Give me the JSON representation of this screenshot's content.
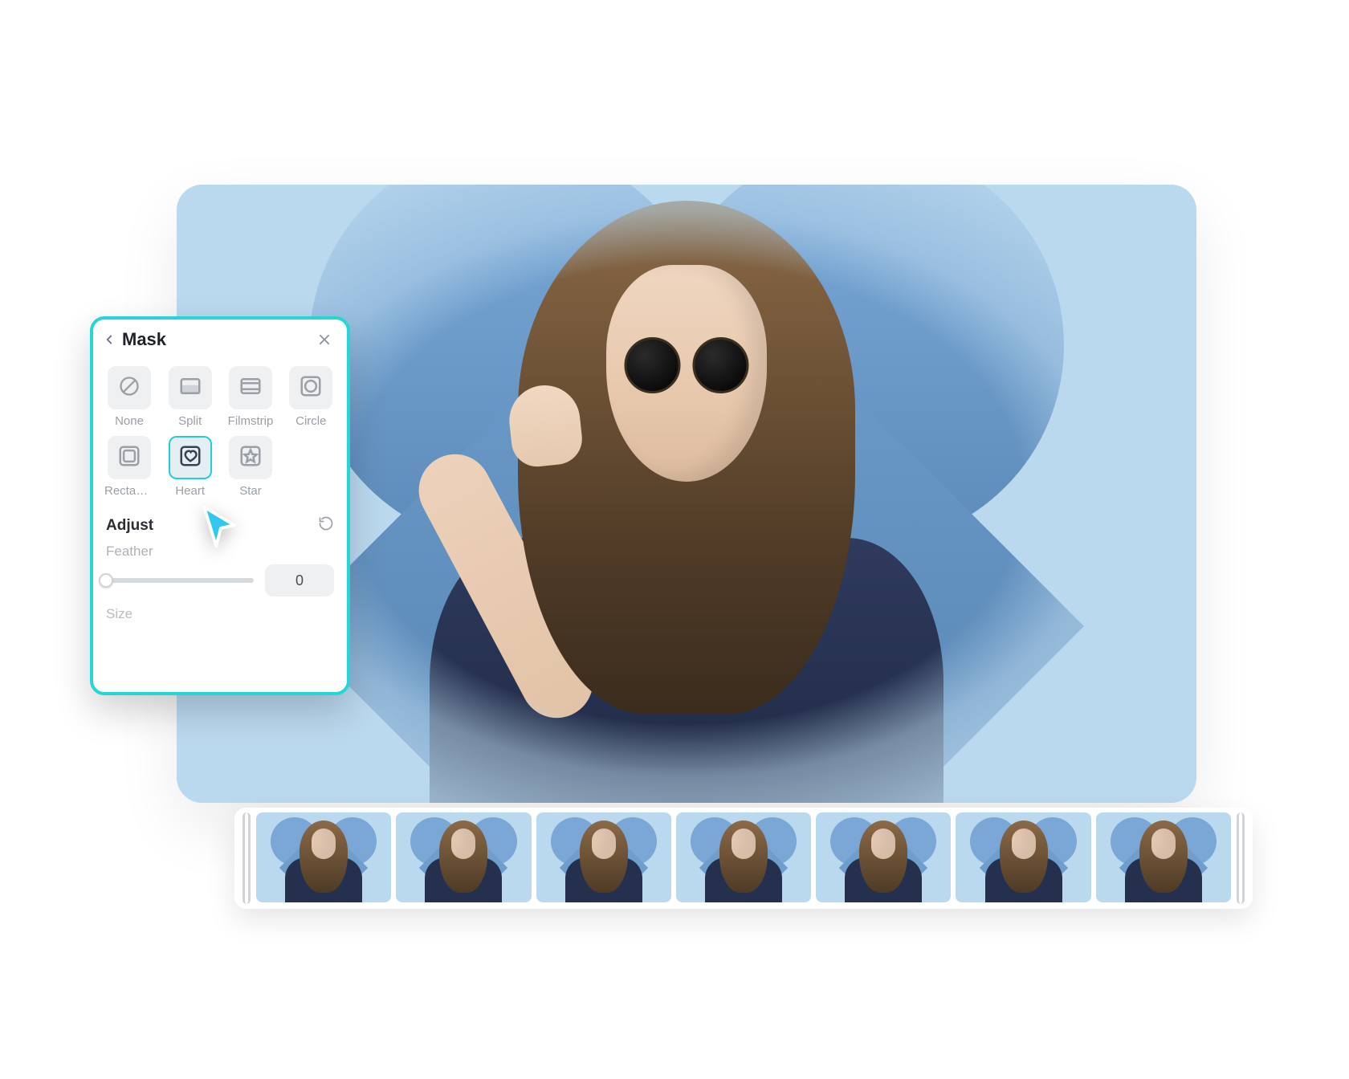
{
  "panel": {
    "title": "Mask",
    "masks": [
      {
        "id": "none",
        "label": "None"
      },
      {
        "id": "split",
        "label": "Split"
      },
      {
        "id": "filmstrip",
        "label": "Filmstrip"
      },
      {
        "id": "circle",
        "label": "Circle"
      },
      {
        "id": "rectangle",
        "label": "Rectang..."
      },
      {
        "id": "heart",
        "label": "Heart",
        "selected": true
      },
      {
        "id": "star",
        "label": "Star"
      }
    ],
    "adjust_title": "Adjust",
    "feather_label": "Feather",
    "feather_value": "0",
    "size_label": "Size"
  },
  "timeline": {
    "frames": 7
  },
  "colors": {
    "accent": "#25d6d6",
    "stage_bg": "#bad8ee"
  }
}
